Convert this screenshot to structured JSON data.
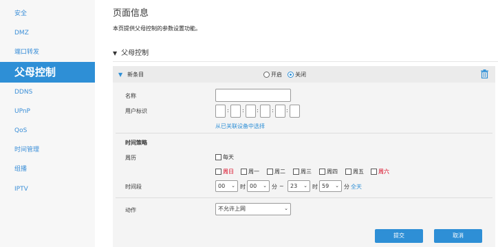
{
  "sidebar": {
    "items": [
      {
        "label": "安全"
      },
      {
        "label": "DMZ"
      },
      {
        "label": "端口转发"
      },
      {
        "label": "父母控制"
      },
      {
        "label": "DDNS"
      },
      {
        "label": "UPnP"
      },
      {
        "label": "QoS"
      },
      {
        "label": "时间管理"
      },
      {
        "label": "组播"
      },
      {
        "label": "IPTV"
      }
    ]
  },
  "page": {
    "title": "页面信息",
    "description": "本页提供父母控制的参数设置功能。",
    "section_title": "父母控制"
  },
  "entry": {
    "title": "新条目",
    "radio_on_label": "开启",
    "radio_off_label": "关闭",
    "selected": "关闭",
    "name_label": "名称",
    "name_value": "",
    "user_id_label": "用户标识",
    "select_device_link": "从已关联设备中选择",
    "time_policy_label": "时间策略",
    "period_label": "周历",
    "everyday_label": "每天",
    "days": [
      "周日",
      "周一",
      "周二",
      "周三",
      "周四",
      "周五",
      "周六"
    ],
    "timespan_label": "时间段",
    "start_hour": "00",
    "start_min": "00",
    "end_hour": "23",
    "end_min": "59",
    "hour_unit": "时",
    "min_unit": "分",
    "tilde": "~",
    "allday_link": "全天",
    "action_label": "动作",
    "action_value": "不允许上网"
  },
  "buttons": {
    "submit": "提交",
    "cancel": "取消"
  },
  "colors": {
    "accent": "#2e8fd6",
    "weekend": "#d9001b"
  }
}
